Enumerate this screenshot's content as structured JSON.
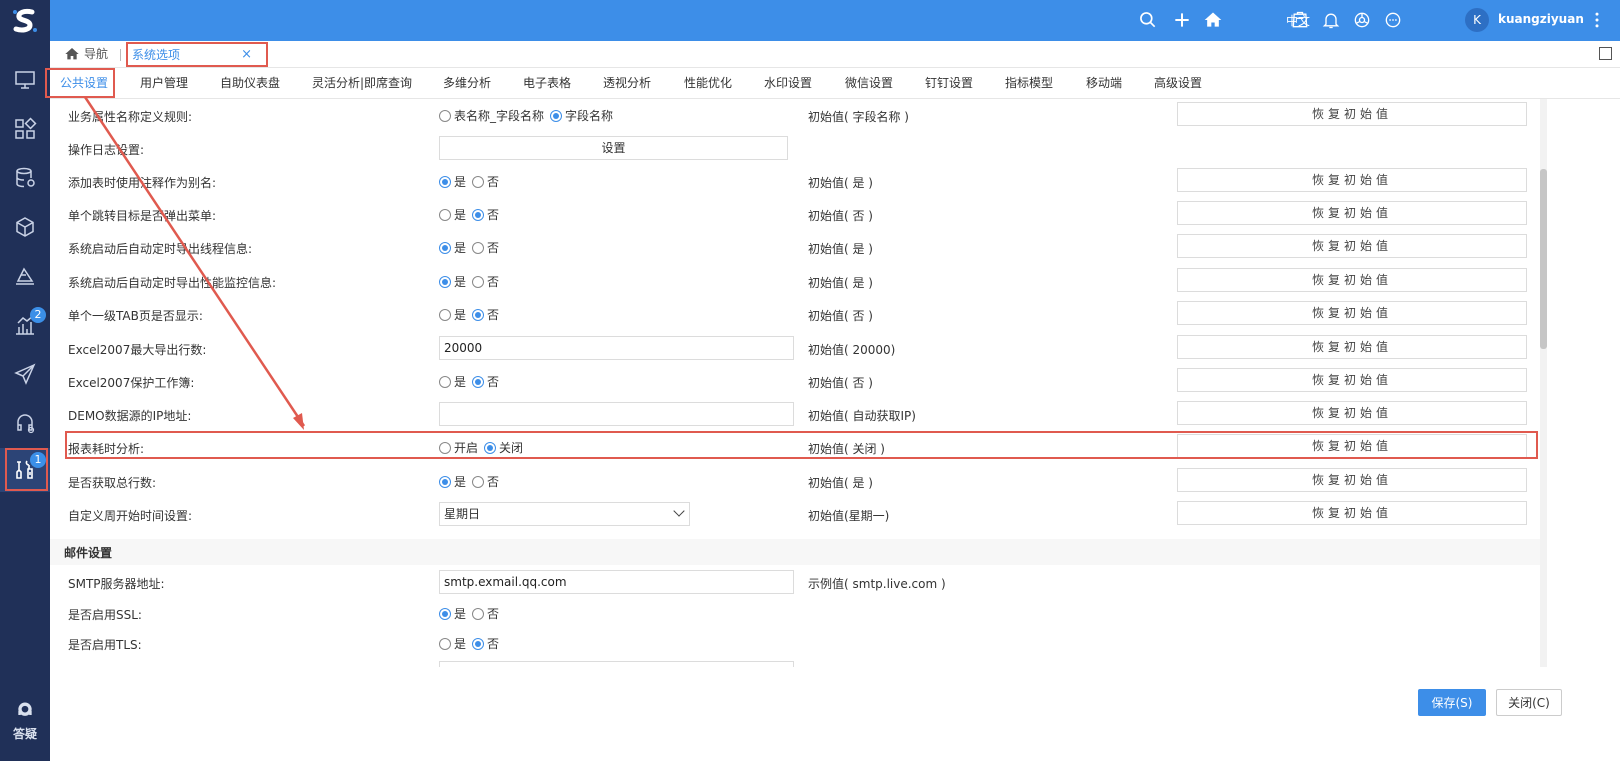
{
  "sidebar": {
    "logo": "S",
    "items": [
      {
        "icon": "monitor-icon"
      },
      {
        "icon": "grid-icon"
      },
      {
        "icon": "database-icon"
      },
      {
        "icon": "cube-icon"
      },
      {
        "icon": "ruler-icon"
      },
      {
        "icon": "bar-chart-icon",
        "badge": "2"
      },
      {
        "icon": "send-icon"
      },
      {
        "icon": "headset-icon"
      },
      {
        "icon": "tools-icon",
        "badge": "1"
      }
    ],
    "help_label": "答疑"
  },
  "topbar": {
    "lang": "中文",
    "avatar_letter": "K",
    "username": "kuangziyuan"
  },
  "tabbar": {
    "home_label": "导航",
    "active_tab": "系统选项",
    "close_glyph": "×"
  },
  "settings_tabs": [
    "公共设置",
    "用户管理",
    "自助仪表盘",
    "灵活分析|即席查询",
    "多维分析",
    "电子表格",
    "透视分析",
    "性能优化",
    "水印设置",
    "微信设置",
    "钉钉设置",
    "指标模型",
    "移动端",
    "高级设置"
  ],
  "reset_label": "恢复初始值",
  "rows": [
    {
      "label": "业务属性名称定义规则:",
      "options": [
        "表名称_字段名称",
        "字段名称"
      ],
      "selected": 1,
      "init": "初始值( 字段名称 )"
    },
    {
      "label": "操作日志设置:",
      "button": "设置"
    },
    {
      "label": "添加表时使用注释作为别名:",
      "options": [
        "是",
        "否"
      ],
      "selected": 0,
      "init": "初始值( 是 )"
    },
    {
      "label": "单个跳转目标是否弹出菜单:",
      "options": [
        "是",
        "否"
      ],
      "selected": 1,
      "init": "初始值( 否 )"
    },
    {
      "label": "系统启动后自动定时导出线程信息:",
      "options": [
        "是",
        "否"
      ],
      "selected": 0,
      "init": "初始值( 是 )"
    },
    {
      "label": "系统启动后自动定时导出性能监控信息:",
      "options": [
        "是",
        "否"
      ],
      "selected": 0,
      "init": "初始值( 是 )"
    },
    {
      "label": "单个一级TAB页是否显示:",
      "options": [
        "是",
        "否"
      ],
      "selected": 1,
      "init": "初始值( 否 )"
    },
    {
      "label": "Excel2007最大导出行数:",
      "input": "20000",
      "init": "初始值( 20000)"
    },
    {
      "label": "Excel2007保护工作簿:",
      "options": [
        "是",
        "否"
      ],
      "selected": 1,
      "init": "初始值( 否 )"
    },
    {
      "label": "DEMO数据源的IP地址:",
      "input": "",
      "init": "初始值( 自动获取IP)"
    },
    {
      "label": "报表耗时分析:",
      "options": [
        "开启",
        "关闭"
      ],
      "selected": 1,
      "init": "初始值( 关闭 )"
    },
    {
      "label": "是否获取总行数:",
      "options": [
        "是",
        "否"
      ],
      "selected": 0,
      "init": "初始值( 是 )"
    },
    {
      "label": "自定义周开始时间设置:",
      "select": "星期日",
      "init": "初始值(星期一)"
    }
  ],
  "mail_section": {
    "title": "邮件设置",
    "rows": [
      {
        "label": "SMTP服务器地址:",
        "input": "smtp.exmail.qq.com",
        "init": "示例值( smtp.live.com )"
      },
      {
        "label": "是否启用SSL:",
        "options": [
          "是",
          "否"
        ],
        "selected": 0
      },
      {
        "label": "是否启用TLS:",
        "options": [
          "是",
          "否"
        ],
        "selected": 1
      }
    ]
  },
  "footer": {
    "save_label": "保存(S)",
    "close_label": "关闭(C)"
  },
  "colors": {
    "sidebar": "#203058",
    "topbar": "#3d8ee8",
    "accent": "#3d8ee8",
    "highlight": "#e05a4f"
  }
}
